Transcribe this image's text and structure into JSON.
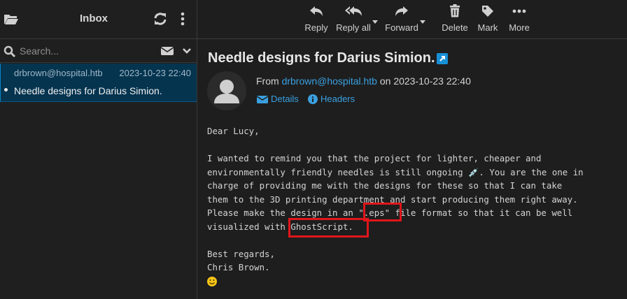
{
  "sidebar": {
    "title": "Inbox",
    "search_placeholder": "Search...",
    "messages": [
      {
        "from": "drbrown@hospital.htb",
        "date": "2023-10-23 22:40",
        "subject": "Needle designs for Darius Simion."
      }
    ]
  },
  "toolbar": {
    "reply": "Reply",
    "reply_all": "Reply all",
    "forward": "Forward",
    "delete": "Delete",
    "mark": "Mark",
    "more": "More"
  },
  "message": {
    "subject": "Needle designs for Darius Simion.",
    "from_prefix": "From",
    "from_addr": "drbrown@hospital.htb",
    "on_word": "on",
    "date": "2023-10-23 22:40",
    "details": "Details",
    "headers": "Headers",
    "body": "Dear Lucy,\n\nI wanted to remind you that the project for lighter, cheaper and\nenvironmentally friendly needles is still ongoing 💉. You are the one in\ncharge of providing me with the designs for these so that I can take\nthem to the 3D printing department and start producing them right away.\nPlease make the design in an \".eps\" file format so that it can be well\nvisualized with GhostScript.\n\nBest regards,\nChris Brown."
  },
  "colors": {
    "accent": "#3aa0e0",
    "selected_row": "#05344f",
    "highlight_box": "#e0161a"
  }
}
